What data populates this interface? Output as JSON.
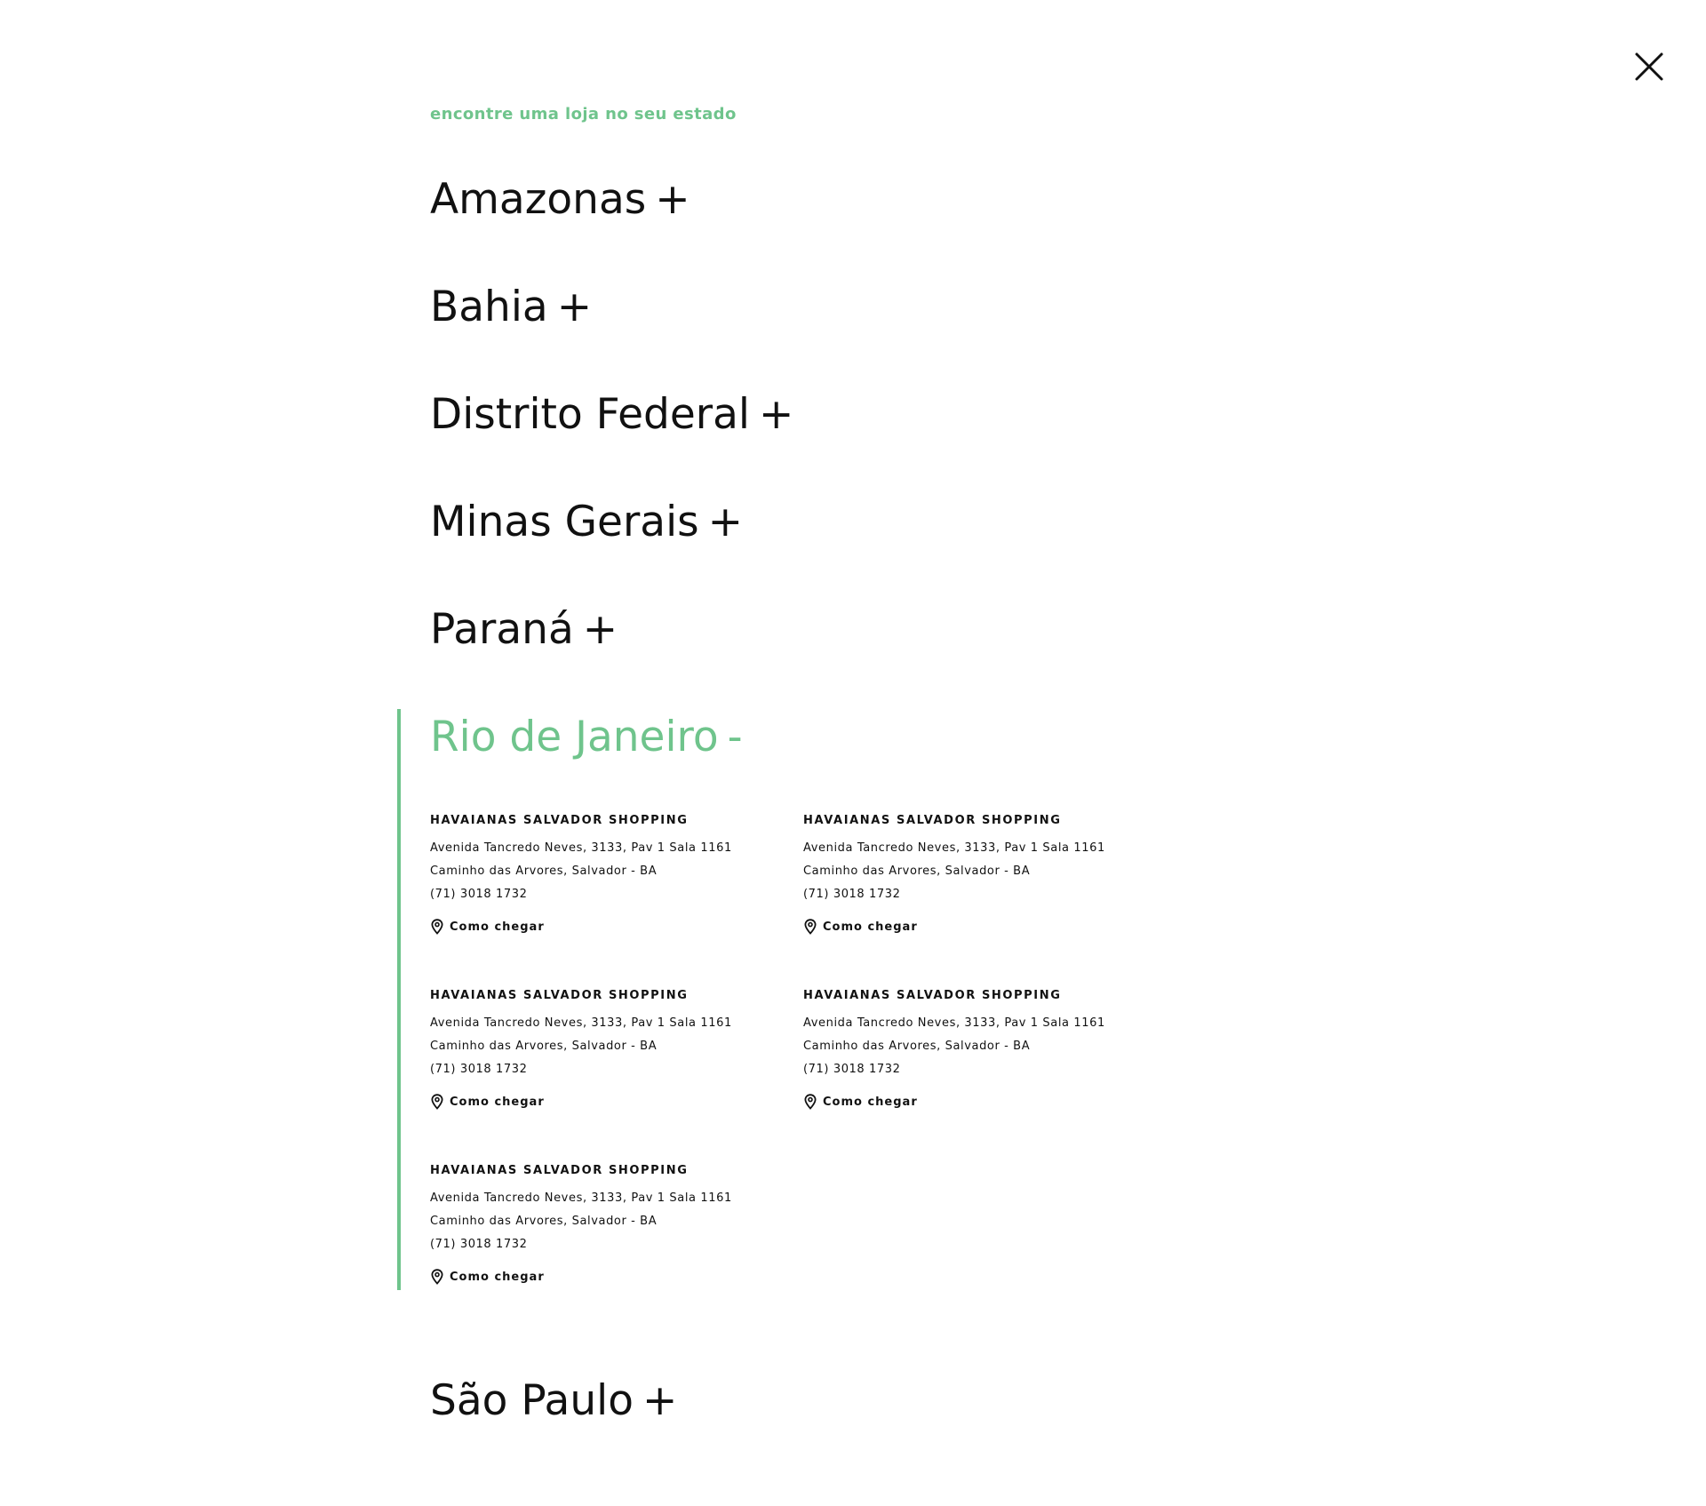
{
  "colors": {
    "accent": "#6fc48c",
    "text": "#111111",
    "background": "#ffffff"
  },
  "close": {
    "icon": "close-icon"
  },
  "header": {
    "eyebrow": "encontre uma loja no seu estado"
  },
  "states": [
    {
      "name": "Amazonas",
      "toggle": "+"
    },
    {
      "name": "Bahia",
      "toggle": "+"
    },
    {
      "name": "Distrito Federal",
      "toggle": "+"
    },
    {
      "name": "Minas Gerais",
      "toggle": "+"
    },
    {
      "name": "Paraná",
      "toggle": "+"
    }
  ],
  "expanded_state": {
    "name": "Rio de Janeiro",
    "toggle": "-",
    "stores": [
      {
        "name": "HAVAIANAS SALVADOR SHOPPING",
        "address1": "Avenida Tancredo Neves, 3133, Pav 1 Sala 1161",
        "address2": "Caminho das Arvores, Salvador - BA",
        "phone": "(71) 3018 1732",
        "directions": "Como chegar",
        "icon": "map-pin-icon"
      },
      {
        "name": "HAVAIANAS SALVADOR SHOPPING",
        "address1": "Avenida Tancredo Neves, 3133, Pav 1 Sala 1161",
        "address2": "Caminho das Arvores, Salvador - BA",
        "phone": "(71) 3018 1732",
        "directions": "Como chegar",
        "icon": "map-pin-icon"
      },
      {
        "name": "HAVAIANAS SALVADOR SHOPPING",
        "address1": "Avenida Tancredo Neves, 3133, Pav 1 Sala 1161",
        "address2": "Caminho das Arvores, Salvador - BA",
        "phone": "(71) 3018 1732",
        "directions": "Como chegar",
        "icon": "map-pin-icon"
      },
      {
        "name": "HAVAIANAS SALVADOR SHOPPING",
        "address1": "Avenida Tancredo Neves, 3133, Pav 1 Sala 1161",
        "address2": "Caminho das Arvores, Salvador - BA",
        "phone": "(71) 3018 1732",
        "directions": "Como chegar",
        "icon": "map-pin-icon"
      },
      {
        "name": "HAVAIANAS SALVADOR SHOPPING",
        "address1": "Avenida Tancredo Neves, 3133, Pav 1 Sala 1161",
        "address2": "Caminho das Arvores, Salvador - BA",
        "phone": "(71) 3018 1732",
        "directions": "Como chegar",
        "icon": "map-pin-icon"
      }
    ]
  },
  "last_state": {
    "name": "São Paulo",
    "toggle": "+"
  }
}
